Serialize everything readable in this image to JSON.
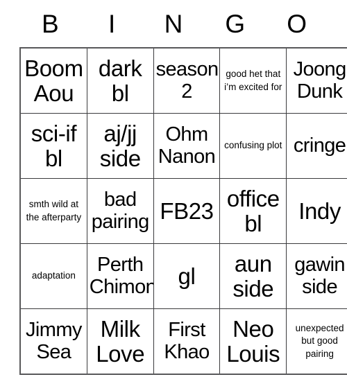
{
  "card": {
    "header": {
      "letters": [
        "B",
        "I",
        "N",
        "G",
        "O"
      ]
    },
    "colors": {
      "background": "#ffffff",
      "text": "#000000",
      "grid_line": "#3a3a3c",
      "grid_outer": "#58585a"
    },
    "rows": [
      [
        {
          "text": "Boom Aou",
          "size": "lg"
        },
        {
          "text": "dark bl",
          "size": "lg"
        },
        {
          "text": "season 2",
          "size": "md"
        },
        {
          "text": "good het that i’m excited for",
          "size": "sm"
        },
        {
          "text": "Joong Dunk",
          "size": "md"
        }
      ],
      [
        {
          "text": "sci-if bl",
          "size": "lg"
        },
        {
          "text": "aj/jj side",
          "size": "lg"
        },
        {
          "text": "Ohm Nanon",
          "size": "md"
        },
        {
          "text": "confusing plot",
          "size": "sm"
        },
        {
          "text": "cringe",
          "size": "md"
        }
      ],
      [
        {
          "text": "smth wild at the afterparty",
          "size": "sm"
        },
        {
          "text": "bad pairing",
          "size": "md"
        },
        {
          "text": "FB23",
          "size": "lg"
        },
        {
          "text": "office bl",
          "size": "lg"
        },
        {
          "text": "Indy",
          "size": "lg"
        }
      ],
      [
        {
          "text": "adaptation",
          "size": "sm"
        },
        {
          "text": "Perth Chimon",
          "size": "md"
        },
        {
          "text": "gl",
          "size": "lg"
        },
        {
          "text": "aun side",
          "size": "lg"
        },
        {
          "text": "gawin side",
          "size": "md"
        }
      ],
      [
        {
          "text": "Jimmy Sea",
          "size": "md"
        },
        {
          "text": "Milk Love",
          "size": "lg"
        },
        {
          "text": "First Khao",
          "size": "md"
        },
        {
          "text": "Neo Louis",
          "size": "lg"
        },
        {
          "text": "unexpected but good pairing",
          "size": "sm"
        }
      ]
    ]
  }
}
